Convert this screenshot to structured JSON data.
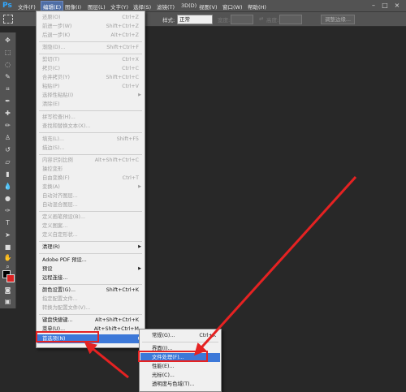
{
  "app": {
    "logo": "Ps"
  },
  "menubar": [
    {
      "label": "文件(F)"
    },
    {
      "label": "编辑(E)",
      "active": true
    },
    {
      "label": "图像(I)"
    },
    {
      "label": "图层(L)"
    },
    {
      "label": "文字(Y)"
    },
    {
      "label": "选择(S)"
    },
    {
      "label": "滤镜(T)"
    },
    {
      "label": "3D(D)"
    },
    {
      "label": "视图(V)"
    },
    {
      "label": "窗口(W)"
    },
    {
      "label": "帮助(H)"
    }
  ],
  "options_bar": {
    "style_label": "样式:",
    "style_value": "正常",
    "width_label": "宽度:",
    "height_label": "高度:",
    "refine_edge_button": "调整边缘..."
  },
  "edit_menu": {
    "items": [
      {
        "label": "还原(O)",
        "shortcut": "Ctrl+Z",
        "disabled": true
      },
      {
        "label": "前进一步(W)",
        "shortcut": "Shift+Ctrl+Z",
        "disabled": true
      },
      {
        "label": "后退一步(K)",
        "shortcut": "Alt+Ctrl+Z",
        "disabled": true
      },
      {
        "label": "渐隐(D)...",
        "shortcut": "Shift+Ctrl+F",
        "disabled": true
      },
      {
        "label": "剪切(T)",
        "shortcut": "Ctrl+X",
        "disabled": true
      },
      {
        "label": "拷贝(C)",
        "shortcut": "Ctrl+C",
        "disabled": true
      },
      {
        "label": "合并拷贝(Y)",
        "shortcut": "Shift+Ctrl+C",
        "disabled": true
      },
      {
        "label": "粘贴(P)",
        "shortcut": "Ctrl+V",
        "disabled": true
      },
      {
        "label": "选择性粘贴(I)",
        "shortcut": "",
        "disabled": true,
        "submenu": true
      },
      {
        "label": "清除(E)",
        "shortcut": "",
        "disabled": true
      },
      {
        "label": "拼写检查(H)...",
        "shortcut": "",
        "disabled": true
      },
      {
        "label": "查找和替换文本(X)...",
        "shortcut": "",
        "disabled": true
      },
      {
        "label": "填充(L)...",
        "shortcut": "Shift+F5",
        "disabled": true
      },
      {
        "label": "描边(S)...",
        "shortcut": "",
        "disabled": true
      },
      {
        "label": "内容识别比例",
        "shortcut": "Alt+Shift+Ctrl+C",
        "disabled": true
      },
      {
        "label": "操控变形",
        "shortcut": "",
        "disabled": true
      },
      {
        "label": "自由变换(F)",
        "shortcut": "Ctrl+T",
        "disabled": true
      },
      {
        "label": "变换(A)",
        "shortcut": "",
        "disabled": true,
        "submenu": true
      },
      {
        "label": "自动对齐图层...",
        "shortcut": "",
        "disabled": true
      },
      {
        "label": "自动混合图层...",
        "shortcut": "",
        "disabled": true
      },
      {
        "label": "定义画笔预设(B)...",
        "shortcut": "",
        "disabled": true
      },
      {
        "label": "定义图案...",
        "shortcut": "",
        "disabled": true
      },
      {
        "label": "定义自定形状...",
        "shortcut": "",
        "disabled": true
      },
      {
        "label": "清理(R)",
        "shortcut": "",
        "disabled": false,
        "submenu": true
      },
      {
        "label": "Adobe PDF 预设...",
        "shortcut": "",
        "disabled": false
      },
      {
        "label": "预设",
        "shortcut": "",
        "disabled": false,
        "submenu": true
      },
      {
        "label": "远程连接...",
        "shortcut": "",
        "disabled": false
      },
      {
        "label": "颜色设置(G)...",
        "shortcut": "Shift+Ctrl+K",
        "disabled": false
      },
      {
        "label": "指定配置文件...",
        "shortcut": "",
        "disabled": true
      },
      {
        "label": "转换为配置文件(V)...",
        "shortcut": "",
        "disabled": true
      },
      {
        "label": "键盘快捷键...",
        "shortcut": "Alt+Shift+Ctrl+K",
        "disabled": false
      },
      {
        "label": "菜单(U)...",
        "shortcut": "Alt+Shift+Ctrl+M",
        "disabled": false
      },
      {
        "label": "首选项(N)",
        "shortcut": "",
        "disabled": false,
        "submenu": true,
        "highlighted": true
      }
    ]
  },
  "preferences_submenu": {
    "items": [
      {
        "label": "常规(G)...",
        "shortcut": "Ctrl+K"
      },
      {
        "label": "界面(I)...",
        "shortcut": ""
      },
      {
        "label": "文件处理(F)...",
        "shortcut": "",
        "highlighted": true
      },
      {
        "label": "性能(E)...",
        "shortcut": ""
      },
      {
        "label": "光标(C)...",
        "shortcut": ""
      },
      {
        "label": "透明度与色域(T)...",
        "shortcut": ""
      }
    ]
  },
  "colors": {
    "accent_highlight": "#3c78d8",
    "annotation_red": "#e52222",
    "menubar_bg": "#535353",
    "canvas_bg": "#282828"
  }
}
